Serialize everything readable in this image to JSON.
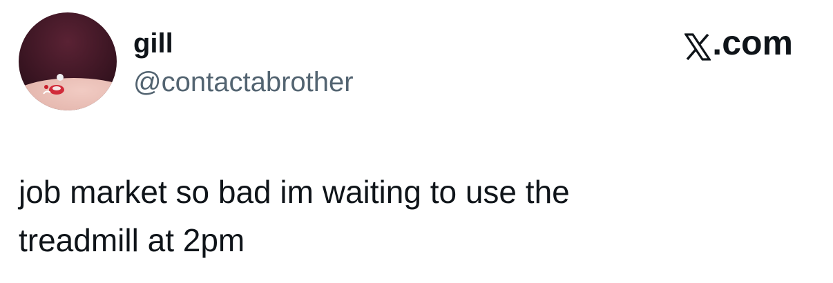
{
  "author": {
    "display_name": "gill",
    "handle": "@contactabrother",
    "avatar_icon": "avatar-image"
  },
  "brand": {
    "icon": "x-logo-icon",
    "label": ".com"
  },
  "tweet": {
    "line1": "job market so bad im waiting to use the",
    "line2": "treadmill at 2pm"
  },
  "colors": {
    "text": "#0f1419",
    "secondary": "#536471",
    "avatar_bg": "#4a1c2b",
    "avatar_skin": "#e8b9b0"
  }
}
